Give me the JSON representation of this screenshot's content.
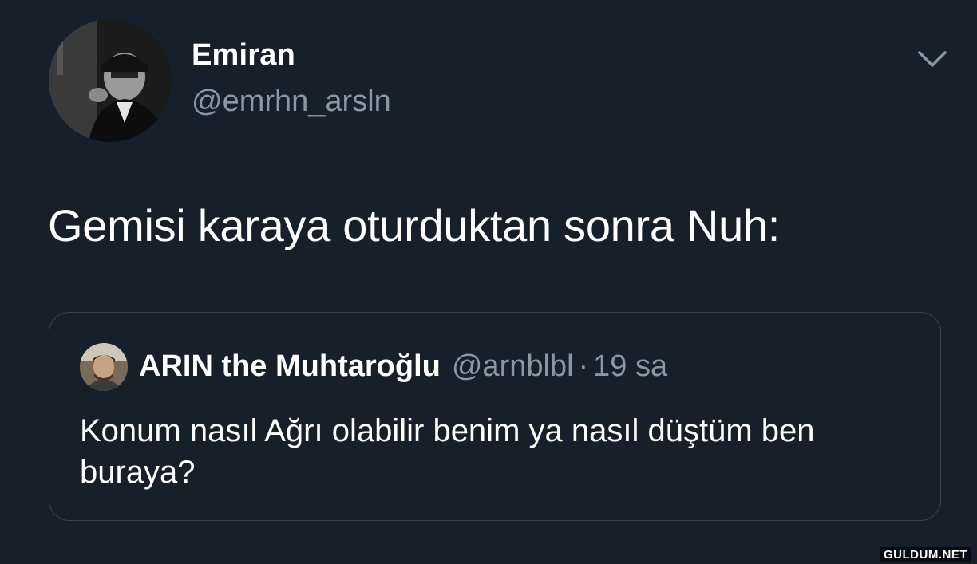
{
  "tweet": {
    "author": {
      "display_name": "Emiran",
      "handle": "@emrhn_arsln",
      "avatar_icon": "user-avatar"
    },
    "menu_icon": "chevron-down-icon",
    "text": "Gemisi karaya oturduktan sonra Nuh:"
  },
  "quoted_tweet": {
    "author": {
      "display_name": "ARIN the Muhtaroğlu",
      "handle": "@arnblbl",
      "avatar_icon": "user-avatar"
    },
    "separator": "·",
    "time": "19 sa",
    "text": "Konum nasıl Ağrı olabilir benim ya nasıl düştüm ben buraya?"
  },
  "watermark": "GULDUM.NET",
  "colors": {
    "background": "#15202b",
    "primary_text": "#ffffff",
    "secondary_text": "#8899a6",
    "border": "#38444d"
  }
}
